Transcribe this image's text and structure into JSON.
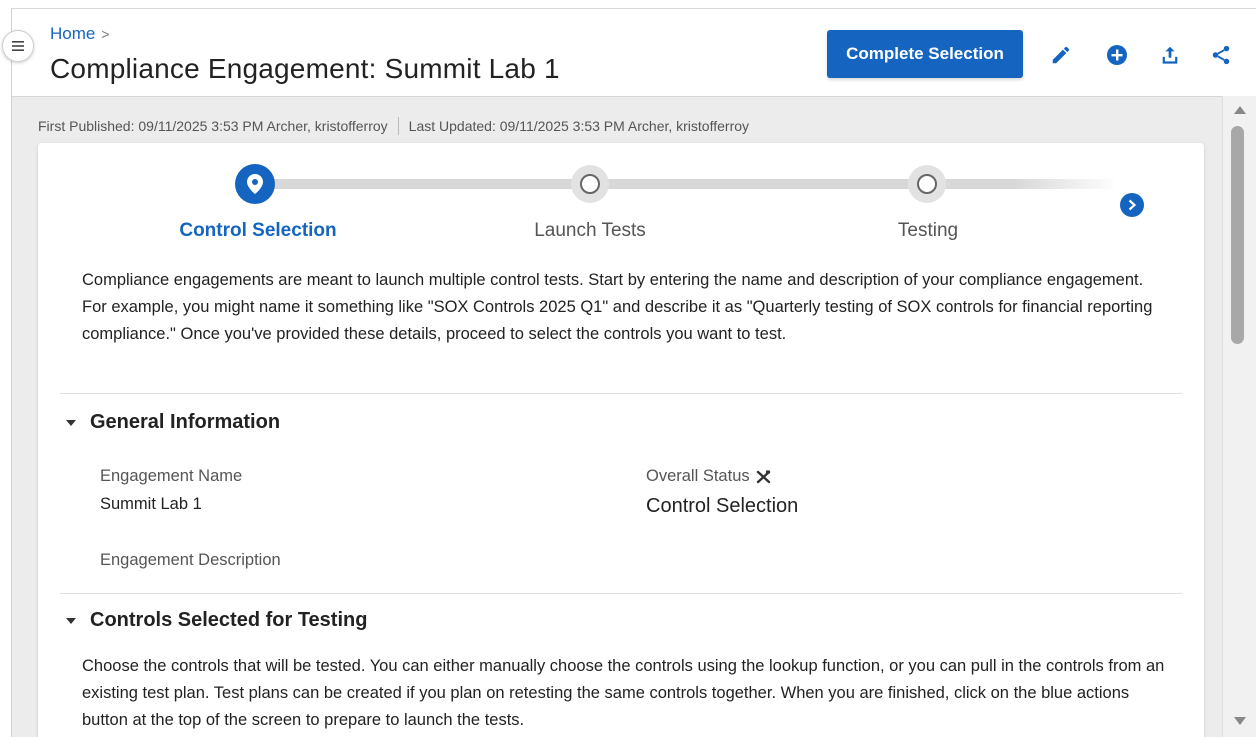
{
  "colors": {
    "accent": "#1565c0",
    "content_bg": "#ececec",
    "text": "#222222",
    "muted": "#555555"
  },
  "header": {
    "breadcrumb": {
      "home": "Home",
      "separator": ">"
    },
    "title": "Compliance Engagement: Summit Lab 1",
    "primary_action": "Complete Selection",
    "icons": [
      "edit-icon",
      "add-circle-icon",
      "export-icon",
      "share-icon"
    ]
  },
  "meta": {
    "first_published": "First Published: 09/11/2025 3:53 PM Archer, kristofferroy",
    "last_updated": "Last Updated: 09/11/2025 3:53 PM Archer, kristofferroy"
  },
  "stepper": {
    "steps": [
      {
        "label": "Control Selection",
        "state": "active"
      },
      {
        "label": "Launch Tests",
        "state": "pending"
      },
      {
        "label": "Testing",
        "state": "pending"
      }
    ]
  },
  "intro": "Compliance engagements are meant to launch multiple control tests. Start by entering the name and description of your compliance engagement. For example, you might name it something like \"SOX Controls 2025 Q1\" and describe it as \"Quarterly testing of SOX controls for financial reporting compliance.\" Once you've provided these details, proceed to select the controls you want to test.",
  "general_information": {
    "heading": "General Information",
    "engagement_name_label": "Engagement Name",
    "engagement_name_value": "Summit Lab 1",
    "overall_status_label": "Overall Status",
    "overall_status_value": "Control Selection",
    "engagement_description_label": "Engagement Description"
  },
  "controls_section": {
    "heading": "Controls Selected for Testing",
    "text": "Choose the controls that will be tested. You can either manually choose the controls using the lookup function, or you can pull in the controls from an existing test plan. Test plans can be created if you plan on retesting the same controls together. When you are finished, click on the blue actions button at the top of the screen to prepare to launch the tests."
  }
}
